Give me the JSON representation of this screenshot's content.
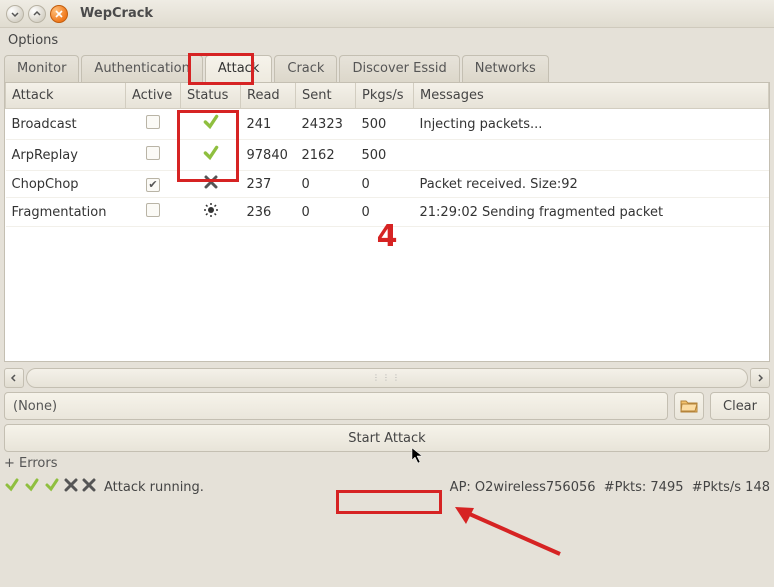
{
  "window": {
    "title": "WepCrack"
  },
  "menubar": {
    "options": "Options"
  },
  "tabs": [
    {
      "label": "Monitor"
    },
    {
      "label": "Authentication"
    },
    {
      "label": "Attack",
      "active": true
    },
    {
      "label": "Crack"
    },
    {
      "label": "Discover Essid"
    },
    {
      "label": "Networks"
    }
  ],
  "table": {
    "headers": {
      "attack": "Attack",
      "active": "Active",
      "status": "Status",
      "read": "Read",
      "sent": "Sent",
      "pkgs": "Pkgs/s",
      "messages": "Messages"
    },
    "rows": [
      {
        "attack": "Broadcast",
        "active": false,
        "status": "ok",
        "read": "241",
        "sent": "24323",
        "pkgs": "500",
        "messages": "Injecting packets..."
      },
      {
        "attack": "ArpReplay",
        "active": false,
        "status": "ok",
        "read": "97840",
        "sent": "2162",
        "pkgs": "500",
        "messages": ""
      },
      {
        "attack": "ChopChop",
        "active": true,
        "status": "fail",
        "read": "237",
        "sent": "0",
        "pkgs": "0",
        "messages": "Packet received. Size:92"
      },
      {
        "attack": "Fragmentation",
        "active": false,
        "status": "working",
        "read": "236",
        "sent": "0",
        "pkgs": "0",
        "messages": "21:29:02  Sending fragmented packet"
      }
    ]
  },
  "annotation": {
    "number": "4"
  },
  "filebar": {
    "value": "(None)",
    "clear": "Clear"
  },
  "start": {
    "label": "Start Attack"
  },
  "errors": {
    "label": "+ Errors"
  },
  "status": {
    "text": "Attack running.",
    "right": "AP: O2wireless756056  #Pkts: 7495  #Pkts/s 148"
  }
}
